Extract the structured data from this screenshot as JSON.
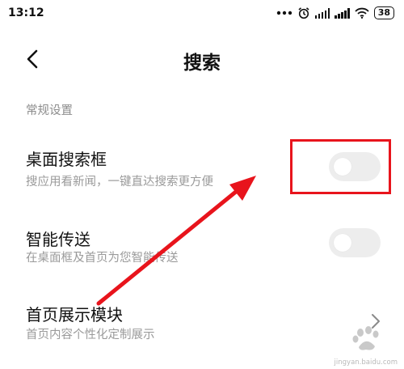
{
  "status_bar": {
    "time": "13:12",
    "battery": "38",
    "icons": [
      "more-dots-icon",
      "alarm-icon",
      "signal-icon",
      "signal-icon",
      "wifi-icon",
      "battery-icon"
    ]
  },
  "header": {
    "title": "搜索",
    "back_icon": "back-arrow-icon"
  },
  "section": {
    "label": "常规设置"
  },
  "settings": [
    {
      "title": "桌面搜索框",
      "subtitle": "搜应用看新闻，一键直达搜索更方便",
      "control": "toggle",
      "enabled": false
    },
    {
      "title": "智能传送",
      "subtitle": "在桌面框及首页为您智能传送",
      "control": "toggle",
      "enabled": false
    },
    {
      "title": "首页展示模块",
      "subtitle": "首页内容个性化定制展示",
      "control": "chevron-right-icon"
    }
  ],
  "annotation": {
    "color": "#e8141c",
    "shapes": [
      "highlight-box",
      "pointer-arrow"
    ]
  },
  "watermark": {
    "text": "jingyan.baidu.com"
  }
}
